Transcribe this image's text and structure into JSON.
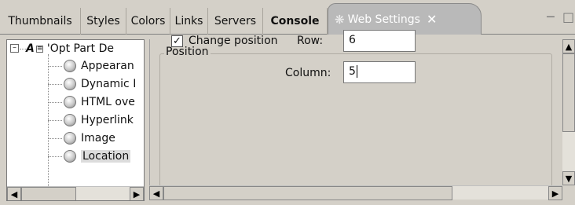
{
  "tabs": [
    {
      "label": "Thumbnails",
      "bold": false
    },
    {
      "label": "Styles",
      "bold": false
    },
    {
      "label": "Colors",
      "bold": false
    },
    {
      "label": "Links",
      "bold": false
    },
    {
      "label": "Servers",
      "bold": false
    },
    {
      "label": "Console",
      "bold": true
    },
    {
      "label": "Web Settings",
      "active": true
    }
  ],
  "tree": {
    "root_label": "'Opt Part  De",
    "items": [
      {
        "label": "Appearan",
        "icon": "edit-node-icon"
      },
      {
        "label": "Dynamic I",
        "icon": "node-icon"
      },
      {
        "label": "HTML ove",
        "icon": "node-icon"
      },
      {
        "label": "Hyperlink",
        "icon": "node-icon"
      },
      {
        "label": "Image",
        "icon": "node-icon"
      },
      {
        "label": "Location",
        "icon": "edit-node-icon",
        "selected": true
      }
    ]
  },
  "position_group": {
    "title": "Position",
    "change_position_label": "Change position",
    "change_position_checked": true,
    "row_label": "Row:",
    "row_value": "6",
    "column_label": "Column:",
    "column_value": "5"
  }
}
